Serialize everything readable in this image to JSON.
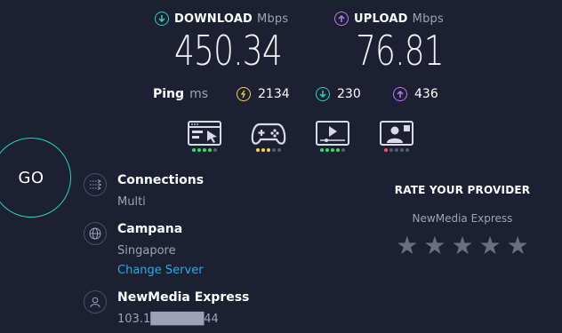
{
  "download": {
    "label": "DOWNLOAD",
    "unit": "Mbps",
    "value": "450.34",
    "color": "#1fd6c0"
  },
  "upload": {
    "label": "UPLOAD",
    "unit": "Mbps",
    "value": "76.81",
    "color": "#b47cf0"
  },
  "ping": {
    "label": "Ping",
    "unit": "ms",
    "idle": "2134",
    "download": "230",
    "upload": "436",
    "idle_color": "#f5d447"
  },
  "activities": [
    {
      "icon": "web-browsing-icon",
      "active_dots": 4,
      "total_dots": 5,
      "dot_color": "#2ee06a"
    },
    {
      "icon": "gaming-controller-icon",
      "active_dots": 3,
      "total_dots": 5,
      "dot_color": "#f5d447"
    },
    {
      "icon": "video-streaming-icon",
      "active_dots": 4,
      "total_dots": 5,
      "dot_color": "#2ee06a"
    },
    {
      "icon": "video-call-icon",
      "active_dots": 1,
      "total_dots": 5,
      "dot_color": "#ff4a6a"
    }
  ],
  "go_button": {
    "label": "GO"
  },
  "connections": {
    "title": "Connections",
    "value": "Multi"
  },
  "server": {
    "title": "Campana",
    "location": "Singapore",
    "change_label": "Change Server"
  },
  "provider": {
    "title": "NewMedia Express",
    "ip": "103.1██████44"
  },
  "rating": {
    "heading": "RATE YOUR PROVIDER",
    "provider_name": "NewMedia Express",
    "stars": 5
  }
}
